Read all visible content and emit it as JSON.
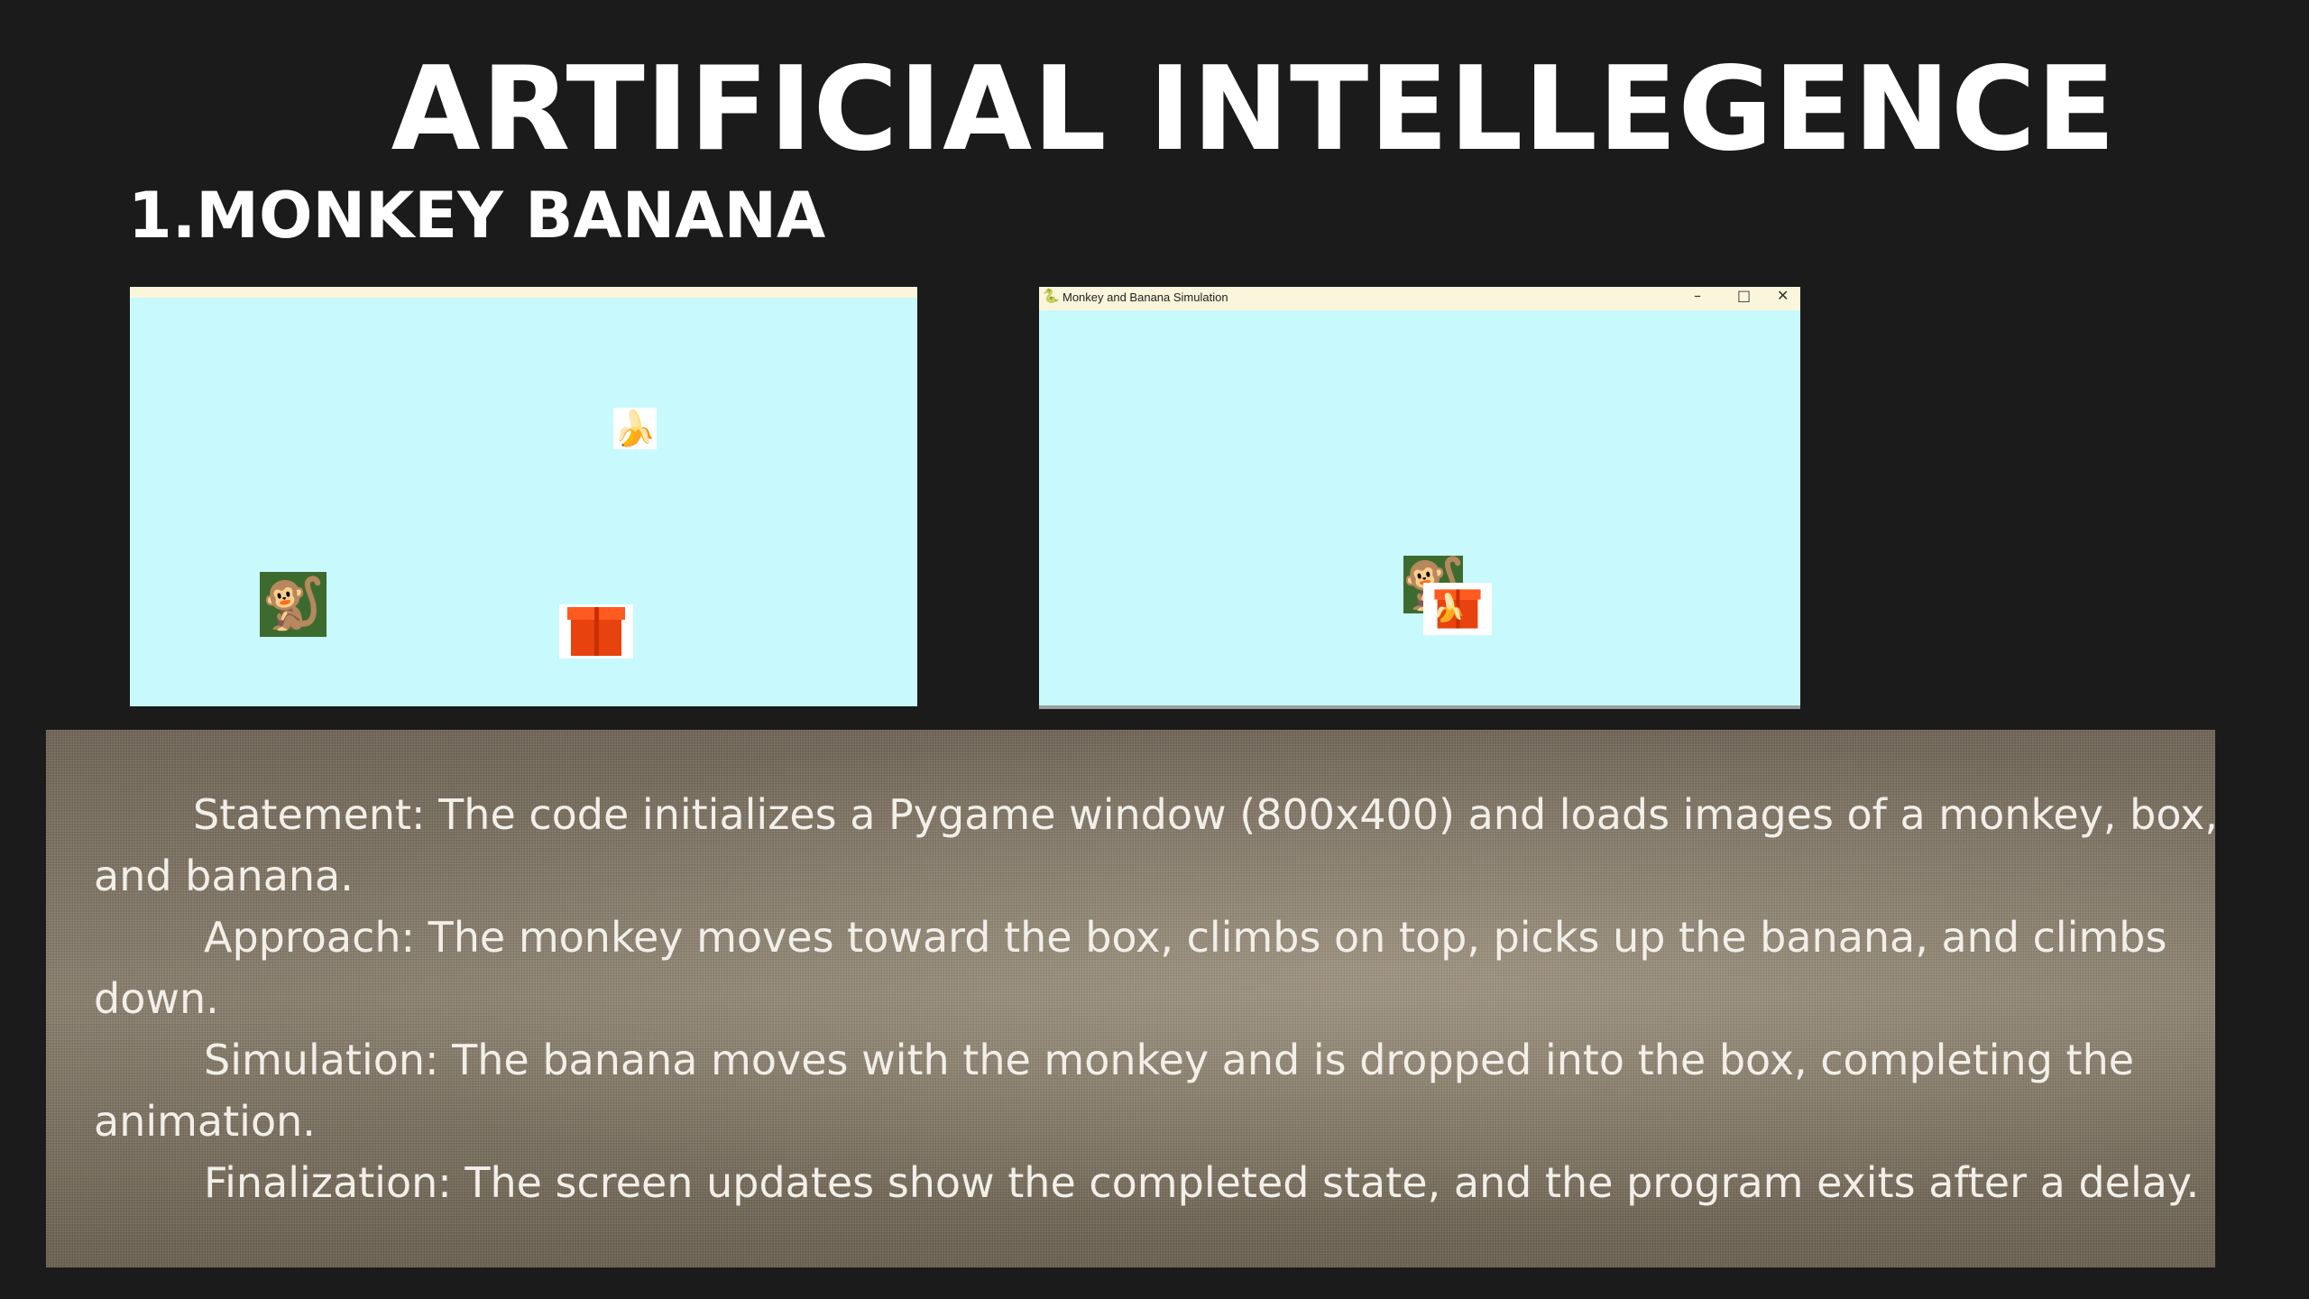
{
  "slide": {
    "title": "ARTIFICIAL INTELLEGENCE",
    "subtitle": "1.MONKEY BANANA"
  },
  "window2": {
    "title": "Monkey and Banana Simulation",
    "controls": {
      "minimize": "–",
      "maximize": "□",
      "close": "✕"
    }
  },
  "icons": {
    "app": "pygame-snake-icon",
    "monkey": "monkey-image",
    "banana": "banana-image",
    "box": "orange-box-image"
  },
  "colors": {
    "background": "#1b1b1b",
    "window_canvas": "#c8f9fd",
    "titlebar": "#fbf5dc",
    "box": "#e8420e"
  },
  "paragraphs": [
    {
      "label": "Statement:",
      "text": " The code initializes a Pygame window (800x400) and loads images of a monkey, box, and banana."
    },
    {
      "label": "Approach:",
      "text": " The monkey moves toward the box, climbs on top, picks up the banana, and climbs down."
    },
    {
      "label": "Simulation:",
      "text": " The banana moves with the monkey and is dropped into the box, completing the animation."
    },
    {
      "label": "Finalization:",
      "text": " The screen updates show the completed state, and the program exits after a delay."
    }
  ]
}
